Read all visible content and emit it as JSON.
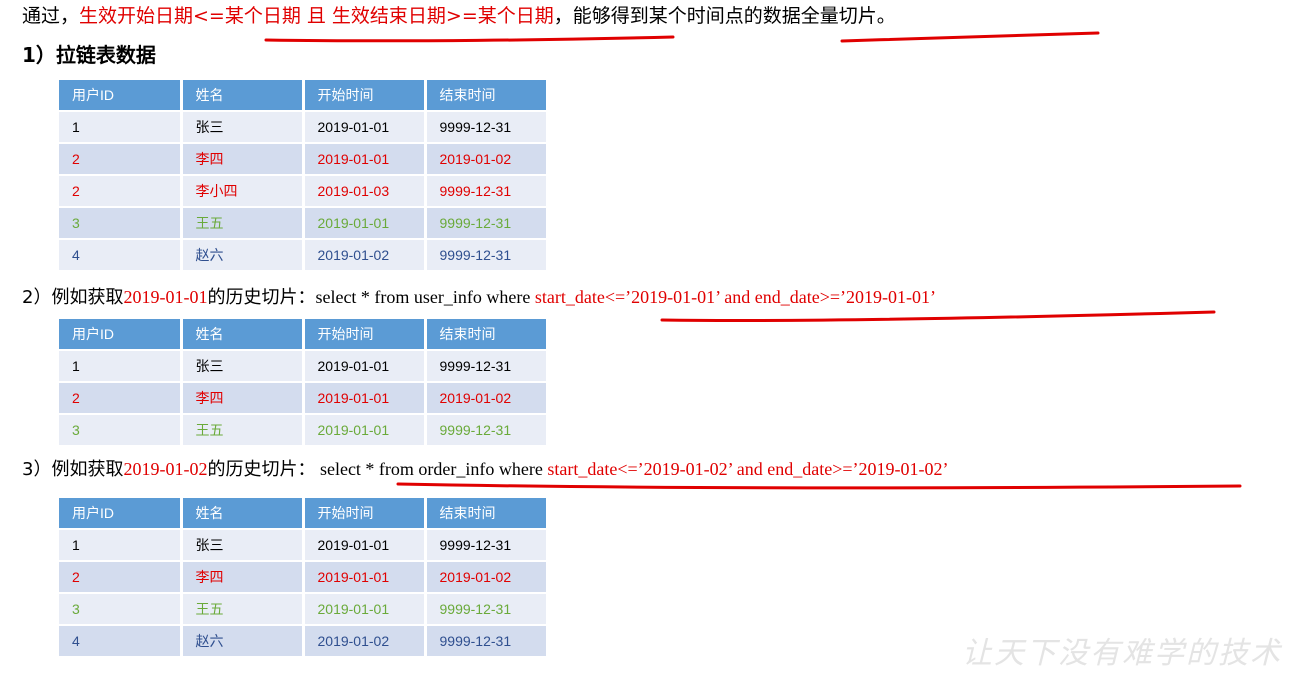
{
  "intro": {
    "prefix": "通过，",
    "highlight": "生效开始日期<=某个日期  且 生效结束日期>=某个日期",
    "suffix": "，能够得到某个时间点的数据全量切片。"
  },
  "heading": "1）拉链表数据",
  "query2": {
    "prefix": "2）例如获取",
    "date": "2019-01-01",
    "mid": "的历史切片：",
    "sql": "select * from user_info where ",
    "cond": "start_date<=’2019-01-01’ and end_date>=’2019-01-01’"
  },
  "query3": {
    "prefix": "3）例如获取",
    "date": "2019-01-02",
    "mid": "的历史切片：",
    "sql": " select * from order_info where ",
    "cond": "start_date<=’2019-01-02’ and end_date>=’2019-01-02’"
  },
  "columns": [
    "用户ID",
    "姓名",
    "开始时间",
    "结束时间"
  ],
  "tables": [
    [
      {
        "kind": "black",
        "cells": [
          "1",
          "张三",
          "2019-01-01",
          "9999-12-31"
        ]
      },
      {
        "kind": "red",
        "cells": [
          "2",
          "李四",
          "2019-01-01",
          "2019-01-02"
        ]
      },
      {
        "kind": "red",
        "cells": [
          "2",
          "李小四",
          "2019-01-03",
          "9999-12-31"
        ]
      },
      {
        "kind": "green",
        "cells": [
          "3",
          "王五",
          "2019-01-01",
          "9999-12-31"
        ]
      },
      {
        "kind": "blue",
        "cells": [
          "4",
          "赵六",
          "2019-01-02",
          "9999-12-31"
        ]
      }
    ],
    [
      {
        "kind": "black",
        "cells": [
          "1",
          "张三",
          "2019-01-01",
          "9999-12-31"
        ]
      },
      {
        "kind": "red",
        "cells": [
          "2",
          "李四",
          "2019-01-01",
          "2019-01-02"
        ]
      },
      {
        "kind": "green",
        "cells": [
          "3",
          "王五",
          "2019-01-01",
          "9999-12-31"
        ]
      }
    ],
    [
      {
        "kind": "black",
        "cells": [
          "1",
          "张三",
          "2019-01-01",
          "9999-12-31"
        ]
      },
      {
        "kind": "red",
        "cells": [
          "2",
          "李四",
          "2019-01-01",
          "2019-01-02"
        ]
      },
      {
        "kind": "green",
        "cells": [
          "3",
          "王五",
          "2019-01-01",
          "9999-12-31"
        ]
      },
      {
        "kind": "blue",
        "cells": [
          "4",
          "赵六",
          "2019-01-02",
          "9999-12-31"
        ]
      }
    ]
  ],
  "watermark": "让天下没有难学的技术",
  "colors": {
    "red": "#e00000",
    "green": "#6aaa3a",
    "blue": "#2f4f8f",
    "header": "#5b9bd5"
  }
}
